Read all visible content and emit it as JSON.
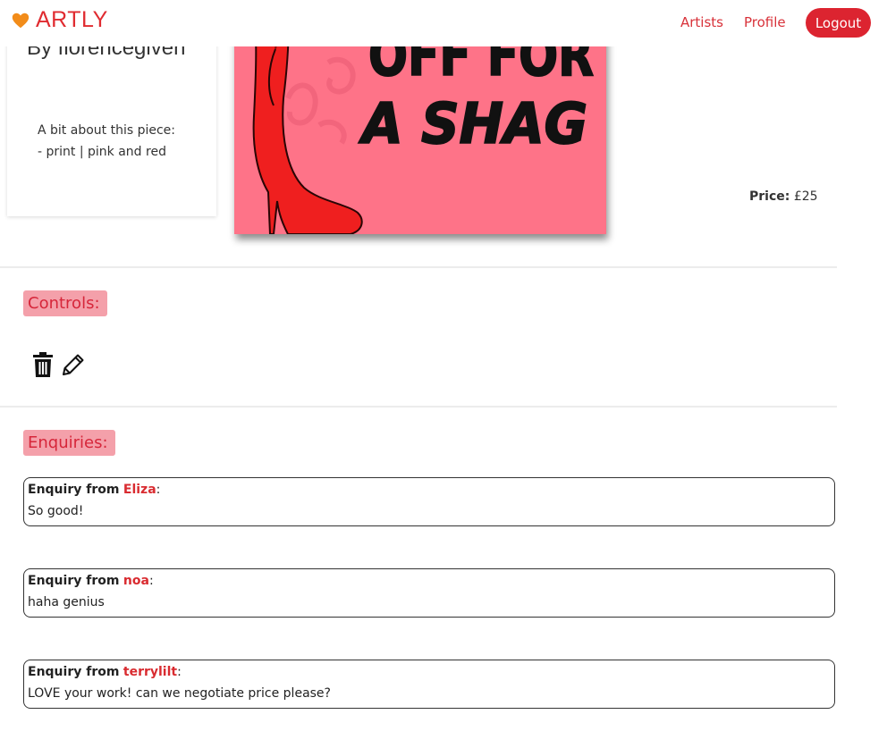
{
  "nav": {
    "brand": "ARTLY",
    "links": [
      "Artists",
      "Profile"
    ],
    "logout": "Logout"
  },
  "artwork": {
    "byline": "By florencegiven",
    "about_heading": "A bit about this piece:",
    "about_detail": "- print | pink and red",
    "image_text": [
      "OFF FOR",
      "A SHAG"
    ],
    "price_label": "Price:",
    "price_value": "£25"
  },
  "controls": {
    "heading": "Controls:",
    "icons": [
      "trash-icon",
      "pencil-icon"
    ]
  },
  "enquiries": {
    "heading": "Enquiries:",
    "prefix": "Enquiry from",
    "items": [
      {
        "name": "Eliza",
        "message": "So good!"
      },
      {
        "name": "noa",
        "message": "haha genius"
      },
      {
        "name": "terrylilt",
        "message": "LOVE your work! can we negotiate price please?"
      }
    ]
  },
  "colors": {
    "accent": "#dc2430",
    "tag_bg": "#f4a0aa",
    "artwork_bg": "#fe7388"
  }
}
